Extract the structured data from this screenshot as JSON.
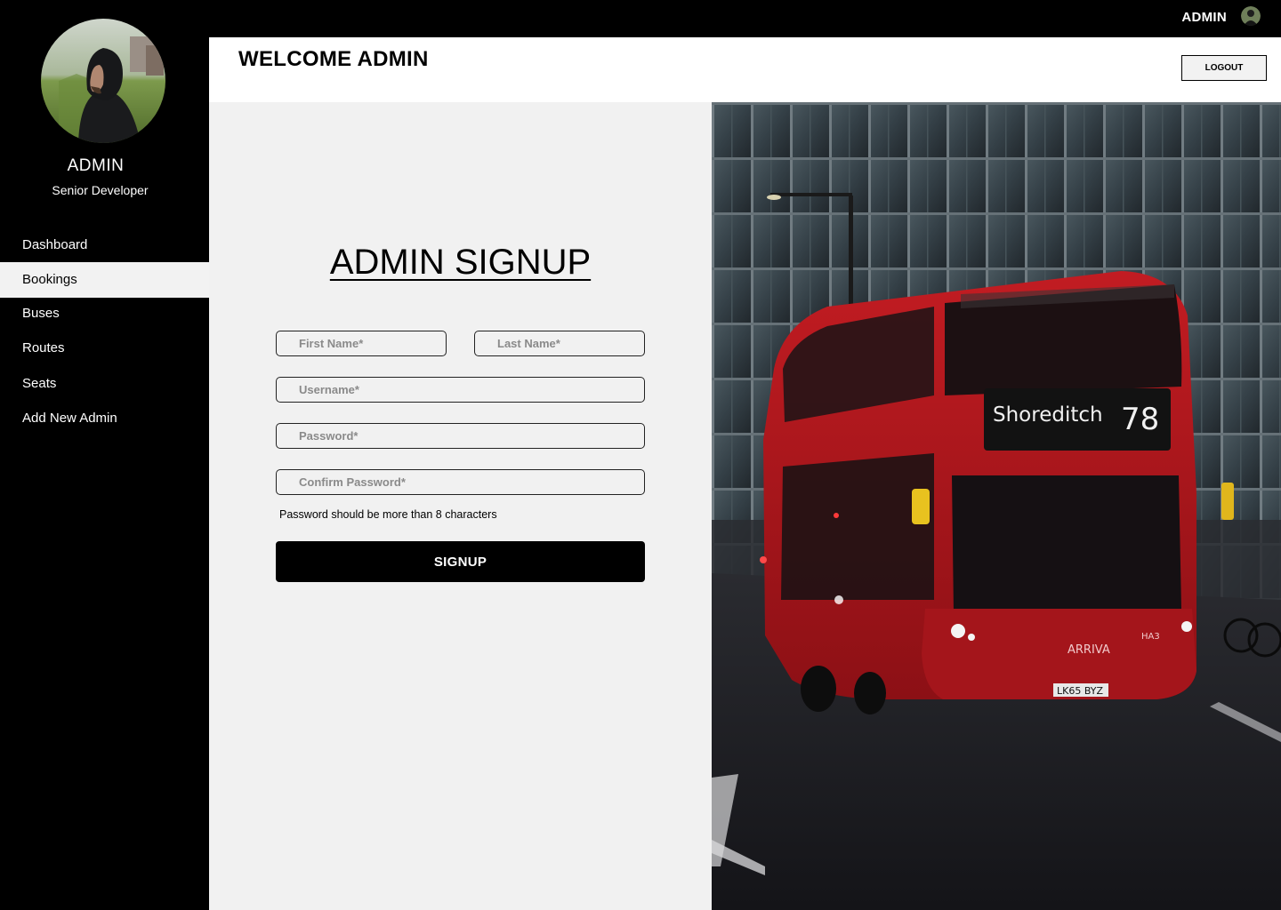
{
  "topbar": {
    "username": "ADMIN"
  },
  "sidebar": {
    "name": "ADMIN",
    "role": "Senior Developer",
    "items": [
      {
        "label": "Dashboard"
      },
      {
        "label": "Bookings",
        "active": true
      },
      {
        "label": "Buses"
      },
      {
        "label": "Routes"
      },
      {
        "label": "Seats"
      },
      {
        "label": "Add New Admin"
      }
    ]
  },
  "header": {
    "title": "WELCOME ADMIN",
    "logout_label": "LOGOUT"
  },
  "form": {
    "title": "ADMIN SIGNUP",
    "first_name_placeholder": "First Name*",
    "last_name_placeholder": "Last Name*",
    "username_placeholder": "Username*",
    "password_placeholder": "Password*",
    "confirm_password_placeholder": "Confirm Password*",
    "password_hint": "Password should be more than 8 characters",
    "submit_label": "SIGNUP"
  },
  "photo": {
    "bus_destination": "Shoreditch",
    "bus_route": "78",
    "bus_operator": "ARRIVA",
    "bus_plate": "LK65 BYZ",
    "bus_code": "HA3"
  },
  "colors": {
    "sidebar_bg": "#000000",
    "panel_bg": "#f1f1f1",
    "bus_red": "#b3161c"
  }
}
